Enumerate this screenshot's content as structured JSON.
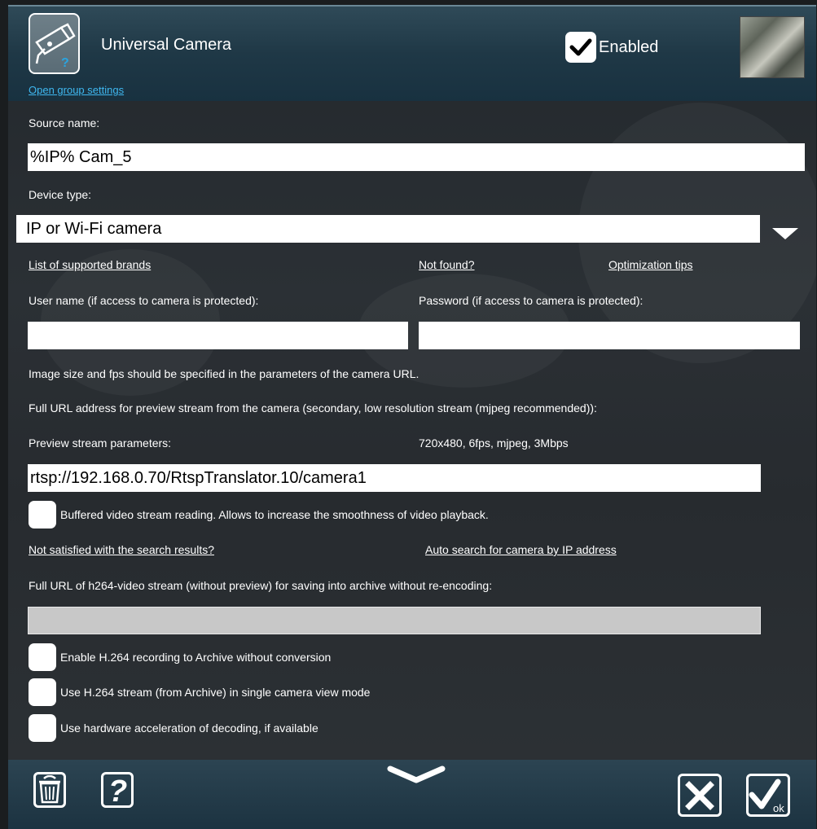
{
  "header": {
    "title": "Universal Camera",
    "group_link": "Open group settings",
    "enabled_label": "Enabled",
    "enabled": true
  },
  "form": {
    "source_name_label": "Source name:",
    "source_name_value": "%IP% Cam_5",
    "device_type_label": "Device type:",
    "device_type_value": "IP or Wi-Fi camera",
    "links": {
      "supported_brands": "List of supported brands",
      "not_found": "Not found?",
      "optimization_tips": "Optimization tips"
    },
    "username_label": "User name (if access to camera is protected):",
    "username_value": "",
    "password_label": "Password (if access to camera is protected):",
    "password_value": "",
    "image_size_note": "Image size and fps should be specified in the parameters of the camera URL.",
    "preview_url_label": "Full URL address for preview stream from the camera (secondary, low resolution stream (mjpeg recommended)):",
    "preview_params_label": "Preview stream parameters:",
    "preview_params_value": "720x480, 6fps, mjpeg, 3Mbps",
    "preview_url_value": "rtsp://192.168.0.70/RtspTranslator.10/camera1",
    "buffered_label": "Buffered video stream reading. Allows to increase the smoothness of video playback.",
    "not_satisfied_link": "Not satisfied with the search results?",
    "auto_search_link": "Auto search for camera by IP address",
    "h264_url_label": "Full URL of h264-video stream (without preview) for saving into archive without re-encoding:",
    "h264_url_value": "",
    "enable_h264_label": "Enable H.264 recording to Archive without conversion",
    "use_h264_label": "Use H.264 stream (from Archive) in single camera view mode",
    "hw_accel_label": "Use hardware acceleration of decoding, if available"
  },
  "footer": {
    "ok_label": "ok"
  },
  "icons": [
    "camera-icon",
    "trash-icon",
    "help-icon",
    "chevron-down-icon",
    "close-icon",
    "ok-icon",
    "dropdown-arrow-icon"
  ]
}
